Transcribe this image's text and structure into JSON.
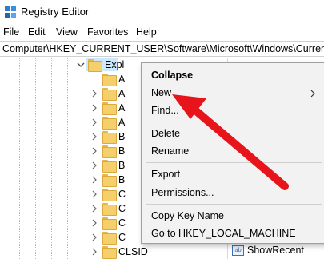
{
  "window": {
    "title": "Registry Editor"
  },
  "menu": [
    "File",
    "Edit",
    "View",
    "Favorites",
    "Help"
  ],
  "address": {
    "path": "Computer\\HKEY_CURRENT_USER\\Software\\Microsoft\\Windows\\CurrentVers"
  },
  "tree": {
    "selected_key": "Expl",
    "children": [
      "A",
      "A",
      "A",
      "A",
      "B",
      "B",
      "B",
      "B",
      "C",
      "C",
      "C",
      "C",
      "CLSID"
    ]
  },
  "context_menu": {
    "collapse": "Collapse",
    "new": "New",
    "find": "Find...",
    "delete": "Delete",
    "rename": "Rename",
    "export": "Export",
    "permissions": "Permissions...",
    "copy_key_name": "Copy Key Name",
    "go_to_hklm": "Go to HKEY_LOCAL_MACHINE"
  },
  "values_pane": {
    "visible_value": "ShowRecent",
    "value_icon": "ab"
  },
  "colors": {
    "arrow": "#e8141b",
    "selection": "#cce8ff",
    "folder": "#f4cf6c"
  }
}
